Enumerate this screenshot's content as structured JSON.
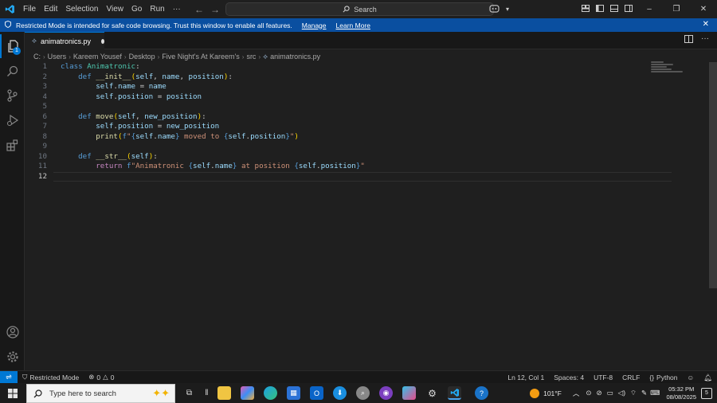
{
  "menu": [
    "File",
    "Edit",
    "Selection",
    "View",
    "Go",
    "Run",
    "···"
  ],
  "search": {
    "placeholder": "Search"
  },
  "banner": {
    "message": "Restricted Mode is intended for safe code browsing. Trust this window to enable all features.",
    "manage_link": "Manage",
    "learn_link": "Learn More"
  },
  "explorer_badge": "1",
  "tab": {
    "filename": "animatronics.py"
  },
  "breadcrumb": [
    "C:",
    "Users",
    "Kareem Yousef",
    "Desktop",
    "Five Night's At Kareem's",
    "src",
    "animatronics.py"
  ],
  "code": {
    "line_numbers": [
      "1",
      "2",
      "3",
      "4",
      "5",
      "6",
      "7",
      "8",
      "9",
      "10",
      "11",
      "12"
    ],
    "current_line": 12
  },
  "status": {
    "mode": "Restricted Mode",
    "errors": "0",
    "warnings": "0",
    "position": "Ln 12, Col 1",
    "spaces": "Spaces: 4",
    "encoding": "UTF-8",
    "eol": "CRLF",
    "language": "Python"
  },
  "taskbar": {
    "search_placeholder": "Type here to search",
    "weather": "101°F",
    "time": "05:32 PM",
    "date": "08/08/2025",
    "notifications": "5"
  },
  "colors": {
    "accent": "#0078d4",
    "banner": "#0a4fa0"
  },
  "icons": [
    "vscode-logo-icon",
    "explorer-icon",
    "search-icon",
    "source-control-icon",
    "run-debug-icon",
    "extensions-icon",
    "account-icon",
    "settings-gear-icon",
    "python-file-icon",
    "windows-start-icon"
  ]
}
